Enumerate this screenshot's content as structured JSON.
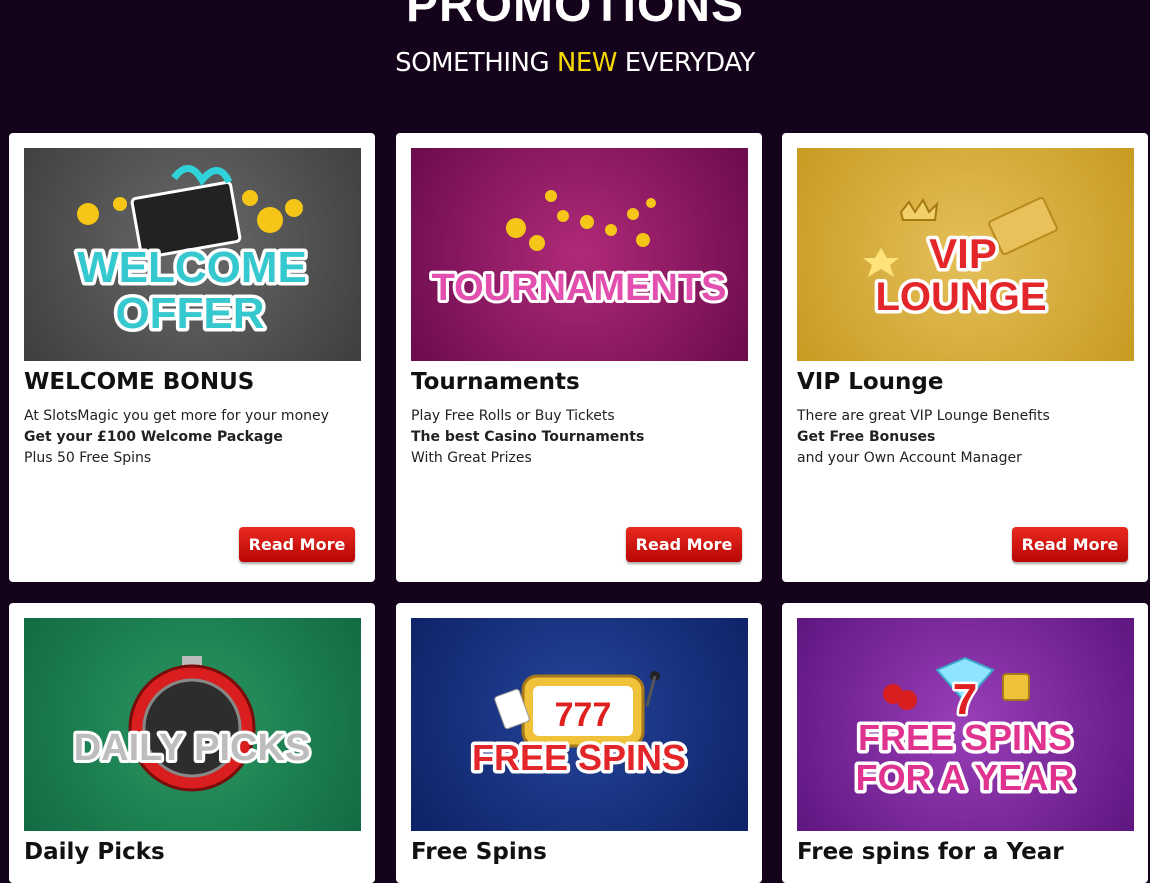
{
  "header": {
    "title": "PROMOTIONS",
    "subtitle_before": "SOMETHING ",
    "subtitle_highlight": "NEW",
    "subtitle_after": " EVERYDAY",
    "highlight_color": "#f5d800"
  },
  "promotions": [
    {
      "image_text_1": "WELCOME",
      "image_text_2": "OFFER",
      "title": "WELCOME BONUS",
      "line1": "At SlotsMagic you get more for your money",
      "line2": "Get your £100 Welcome Package",
      "line3": "Plus 50 Free Spins",
      "button": "Read More"
    },
    {
      "image_text_1": "TOURNAMENTS",
      "title": "Tournaments",
      "line1": "Play Free Rolls or Buy Tickets",
      "line2": "The best Casino Tournaments",
      "line3": "With Great Prizes",
      "button": "Read More"
    },
    {
      "image_text_1": "VIP",
      "image_text_2": "LOUNGE",
      "title": "VIP Lounge",
      "line1": "There are great VIP Lounge Benefits",
      "line2": "Get Free Bonuses",
      "line3": "and your Own Account Manager",
      "button": "Read More"
    },
    {
      "image_text_1": "DAILY PICKS",
      "title": "Daily Picks"
    },
    {
      "image_text_1": "FREE SPINS",
      "image_text_2": "777",
      "title": "Free Spins"
    },
    {
      "image_text_1": "FREE SPINS",
      "image_text_2": "FOR A YEAR",
      "image_text_3": "7",
      "title": "Free spins for a Year"
    }
  ],
  "colors": {
    "page_background": "#14031a",
    "button_red": "#d0150f",
    "card_background": "#ffffff"
  }
}
